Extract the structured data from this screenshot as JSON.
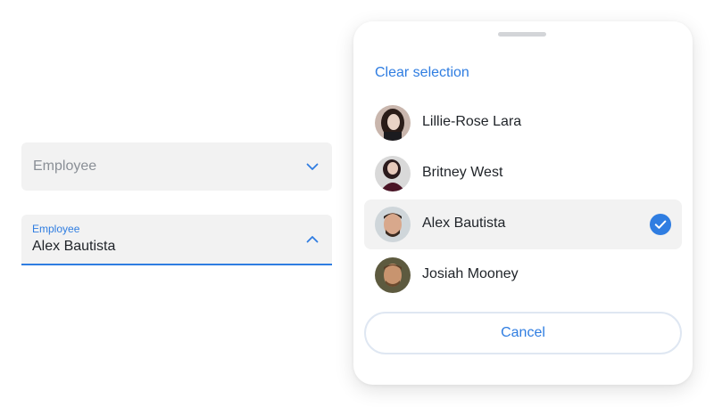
{
  "field_closed": {
    "placeholder": "Employee",
    "icon": "chevron-down-icon"
  },
  "field_open": {
    "label": "Employee",
    "value": "Alex Bautista",
    "icon": "chevron-up-icon"
  },
  "sheet": {
    "clear_label": "Clear selection",
    "options": [
      {
        "name": "Lillie-Rose Lara",
        "selected": false
      },
      {
        "name": "Britney West",
        "selected": false
      },
      {
        "name": "Alex Bautista",
        "selected": true
      },
      {
        "name": "Josiah Mooney",
        "selected": false
      }
    ],
    "cancel_label": "Cancel"
  },
  "colors": {
    "accent": "#2f7de1",
    "field_bg": "#f2f2f2",
    "selected_row_bg": "#f2f2f2",
    "placeholder_text": "#8a8f96"
  }
}
